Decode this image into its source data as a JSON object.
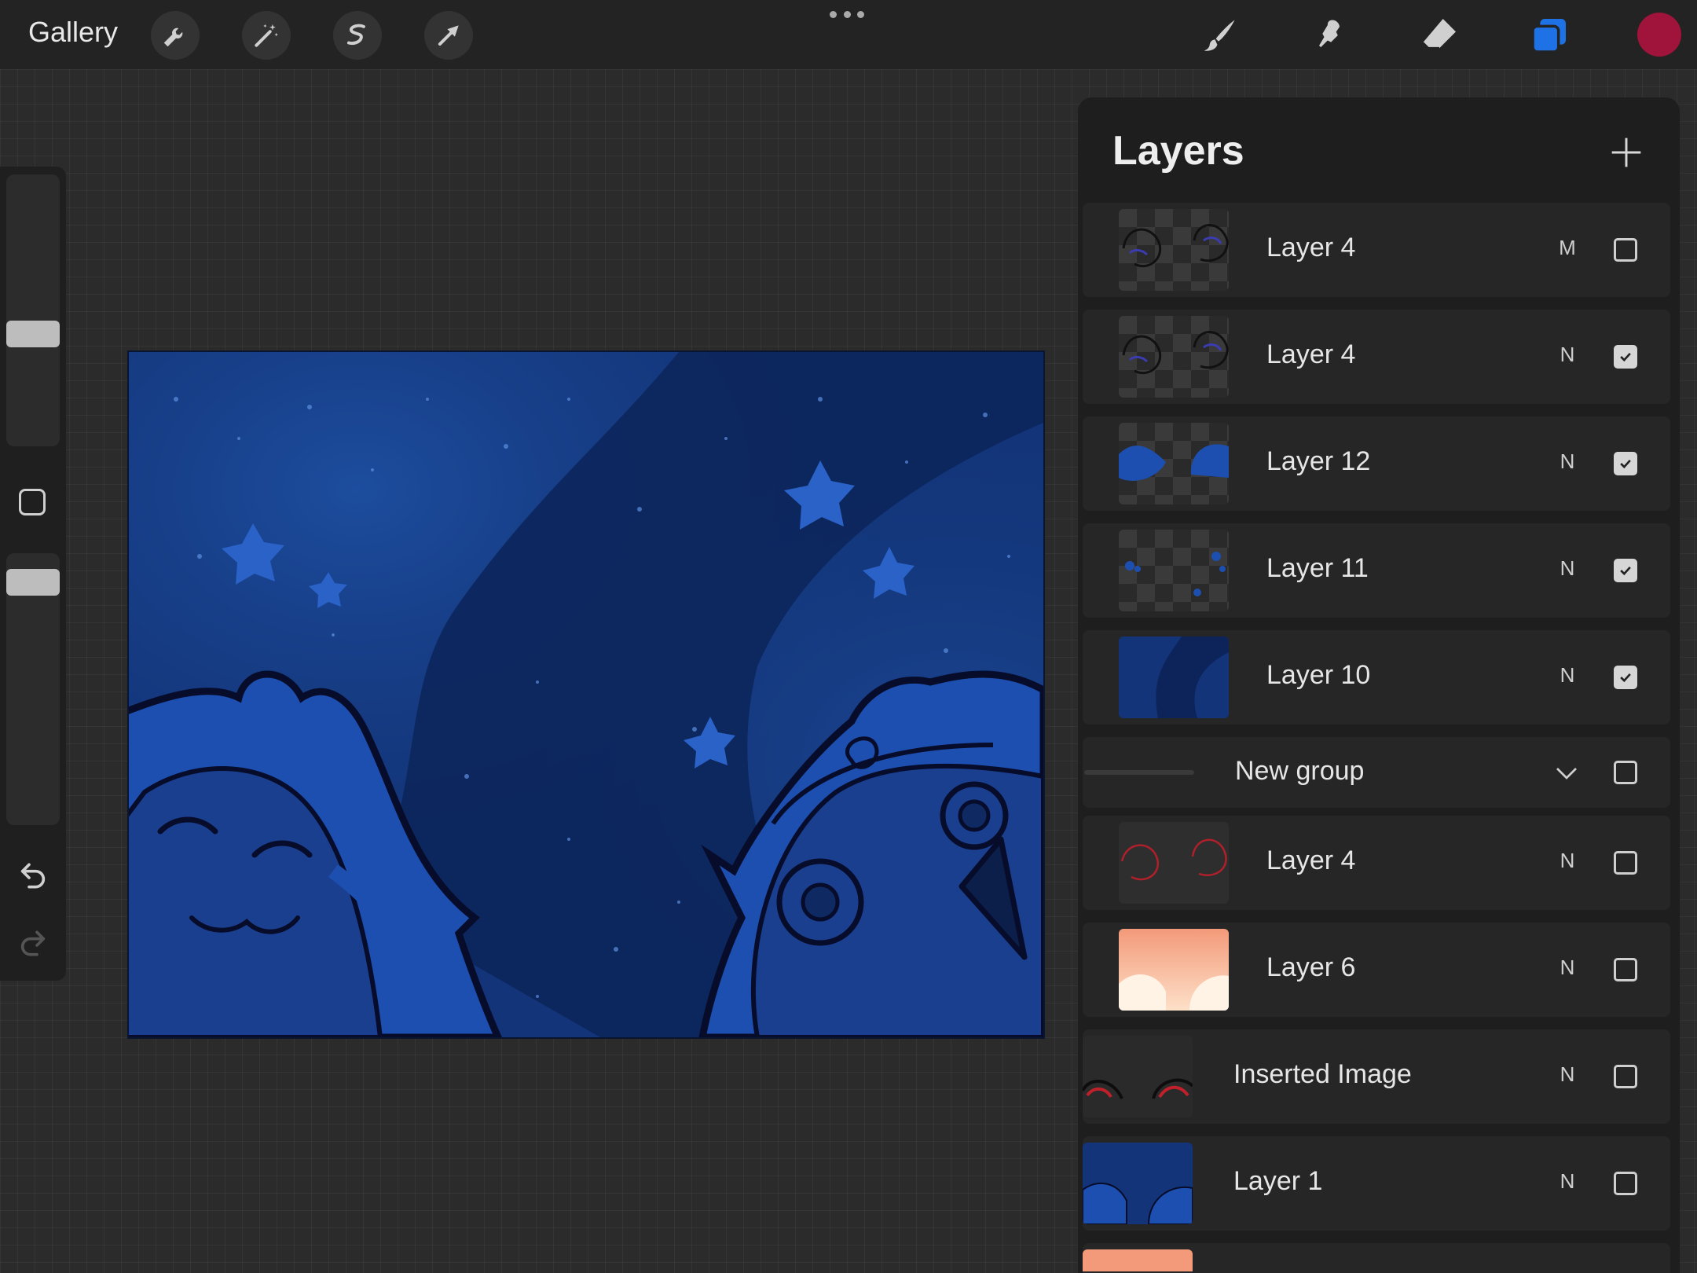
{
  "topbar": {
    "gallery_label": "Gallery",
    "left_tools": [
      "wrench-icon",
      "magic-wand-icon",
      "selection-icon",
      "transform-arrow-icon"
    ],
    "right_tools": [
      "brush-icon",
      "smudge-icon",
      "eraser-icon",
      "layers-icon"
    ],
    "active_color": "#a0143c",
    "layers_accent": "#1e72e6"
  },
  "sidebar": {
    "brush_size_level": 0.6,
    "opacity_level": 0.4,
    "icons": [
      "modifier-square-icon",
      "undo-icon",
      "redo-icon"
    ]
  },
  "layers_panel": {
    "title": "Layers",
    "rows": [
      {
        "name": "Layer 4",
        "mode": "M",
        "visible": false,
        "thumb": "sketch-blue"
      },
      {
        "name": "Layer 4",
        "mode": "N",
        "visible": true,
        "thumb": "sketch-blue"
      },
      {
        "name": "Layer 12",
        "mode": "N",
        "visible": true,
        "thumb": "hair-blue"
      },
      {
        "name": "Layer 11",
        "mode": "N",
        "visible": true,
        "thumb": "stars-blue"
      },
      {
        "name": "Layer 10",
        "mode": "N",
        "visible": true,
        "thumb": "space-blue"
      },
      {
        "name": "New group",
        "mode": "",
        "visible": false,
        "group": true
      },
      {
        "name": "Layer 4",
        "mode": "N",
        "visible": false,
        "thumb": "sketch-red"
      },
      {
        "name": "Layer 6",
        "mode": "N",
        "visible": false,
        "thumb": "peach"
      },
      {
        "name": "Inserted Image",
        "mode": "N",
        "visible": false,
        "thumb": "sketch-red-dark"
      },
      {
        "name": "Layer 1",
        "mode": "N",
        "visible": false,
        "thumb": "full-blue"
      }
    ]
  }
}
